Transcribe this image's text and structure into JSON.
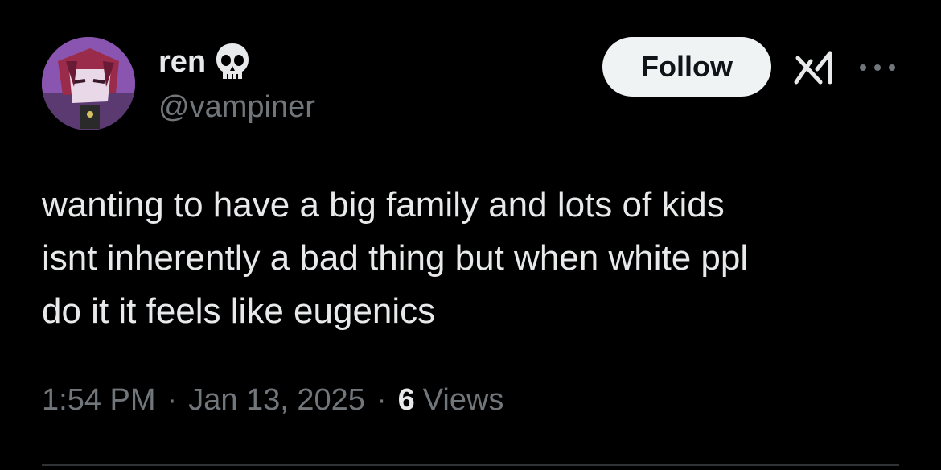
{
  "user": {
    "display_name": "ren",
    "handle": "@vampiner",
    "avatar_icon": "avatar-icon",
    "name_emoji_icon": "skull-icon"
  },
  "actions": {
    "follow_label": "Follow",
    "grok_icon": "grok-icon",
    "more_icon": "more-icon"
  },
  "tweet": {
    "text": "wanting to have a big family and lots of kids\nisnt inherently a bad thing but when white ppl\ndo it it feels like eugenics",
    "time": "1:54 PM",
    "date": "Jan 13, 2025",
    "views_count": "6",
    "views_label": "Views",
    "separator": "·"
  },
  "colors": {
    "background": "#000000",
    "primary_text": "#e7e9ea",
    "secondary_text": "#71767b",
    "follow_bg": "#eff3f4",
    "divider": "#2f3336"
  }
}
